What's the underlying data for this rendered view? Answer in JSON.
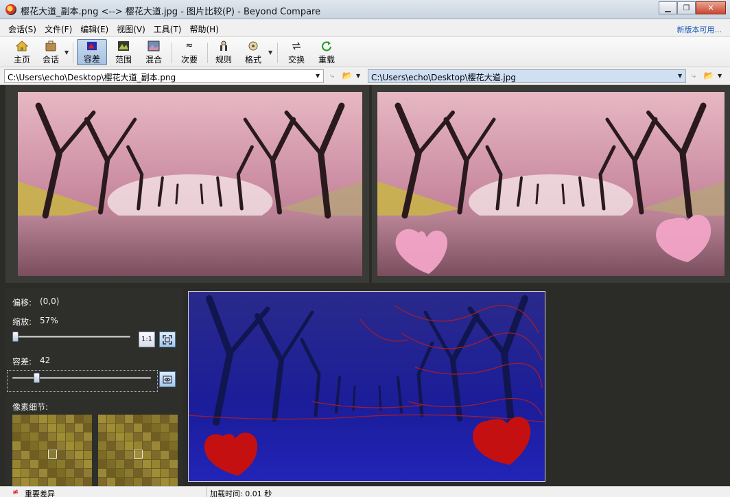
{
  "window": {
    "title": "樱花大道_副本.png <--> 樱花大道.jpg - 图片比较(P) - Beyond Compare",
    "min": "▁",
    "restore": "❐",
    "close": "✕"
  },
  "menu": {
    "items": [
      "会话(S)",
      "文件(F)",
      "编辑(E)",
      "视图(V)",
      "工具(T)",
      "帮助(H)"
    ],
    "new_version": "新版本可用..."
  },
  "toolbar": {
    "home": "主页",
    "sessions": "会话",
    "tolerance": "容差",
    "range": "范围",
    "blend": "混合",
    "minor": "次要",
    "rules": "规则",
    "format": "格式",
    "swap": "交换",
    "reload": "重载"
  },
  "paths": {
    "left": "C:\\Users\\echo\\Desktop\\樱花大道_副本.png",
    "right": "C:\\Users\\echo\\Desktop\\樱花大道.jpg"
  },
  "controls": {
    "offset_label": "偏移:",
    "offset_value": "(0,0)",
    "zoom_label": "缩放:",
    "zoom_value": "57%",
    "zoom_level": 0.0,
    "tolerance_label": "容差:",
    "tolerance_value": "42",
    "tolerance_level": 0.16,
    "pixel_detail_label": "像素细节:",
    "actual_size": "1:1"
  },
  "colors": {
    "diff_red": "#c41010",
    "diff_blue": "#1b1d9a",
    "heart_pink": "#f2a4c6"
  },
  "status": {
    "important_icon": "≠",
    "important_diff": "重要差异",
    "load_time": "加载时间: 0.01 秒"
  }
}
